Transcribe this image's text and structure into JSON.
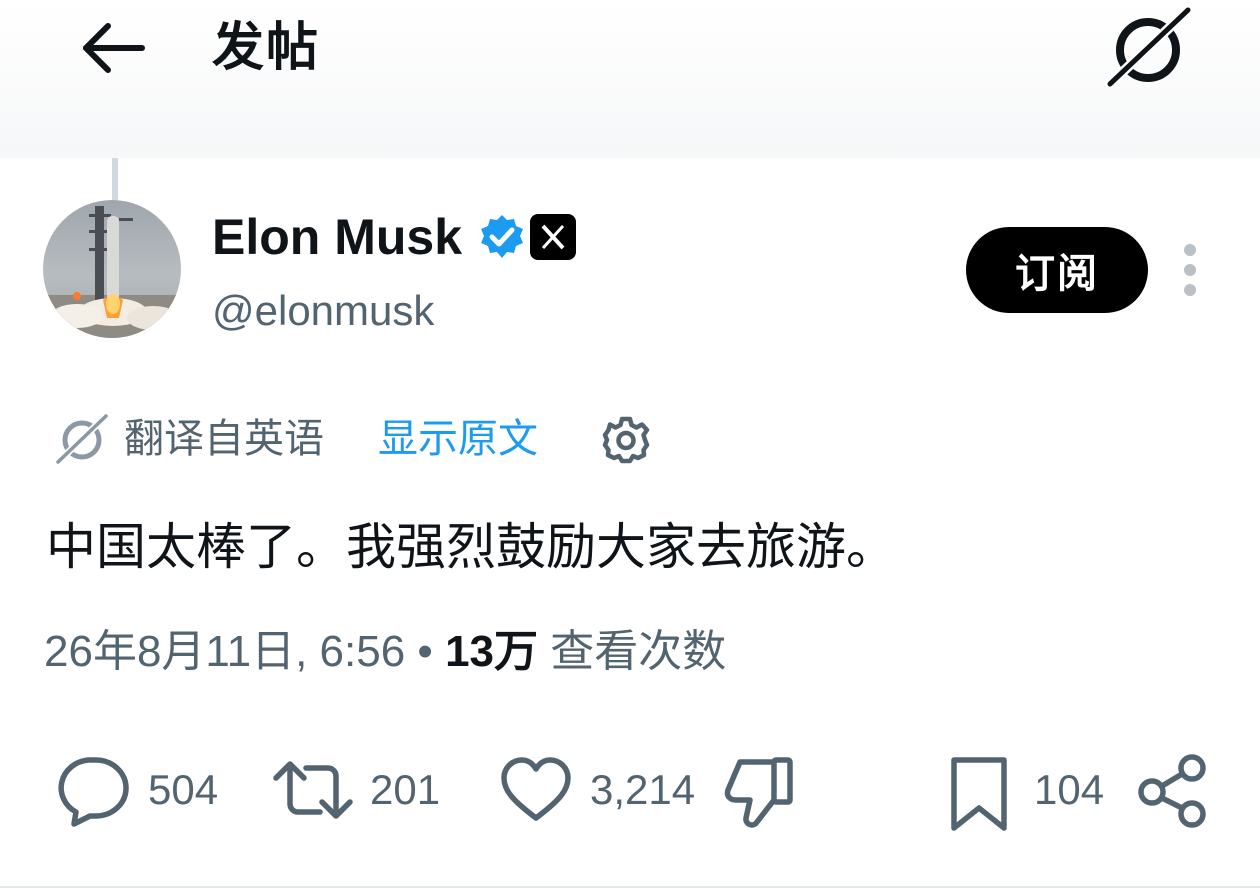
{
  "header": {
    "title": "发帖"
  },
  "author": {
    "name": "Elon Musk",
    "handle": "@elonmusk",
    "subscribe_label": "订阅"
  },
  "translation": {
    "label": "翻译自英语",
    "show_original": "显示原文"
  },
  "tweet": {
    "text": "中国太棒了。我强烈鼓励大家去旅游。",
    "date": "26年8月11日, 6:56",
    "separator": "•",
    "views_count": "13万",
    "views_label": "查看次数"
  },
  "actions": {
    "replies": "504",
    "reposts": "201",
    "likes": "3,214",
    "bookmarks": "104"
  },
  "colors": {
    "accent": "#1d9bf0",
    "secondary_text": "#536471",
    "primary_text": "#0f1419"
  }
}
